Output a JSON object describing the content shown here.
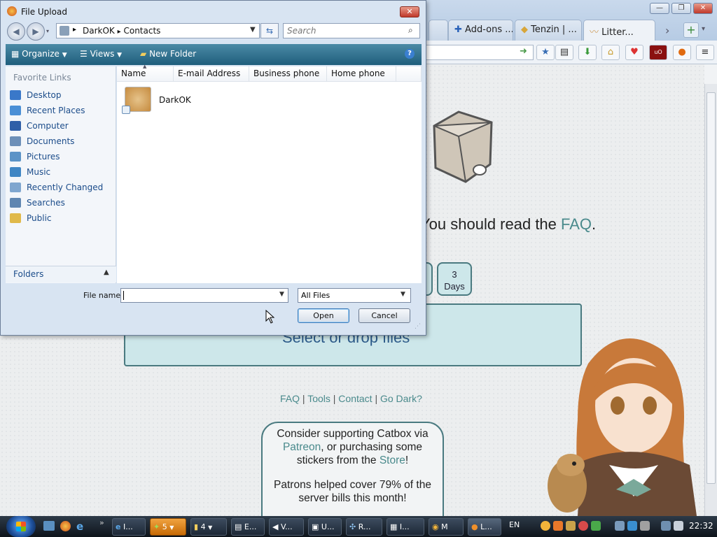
{
  "browser": {
    "tabs": [
      {
        "label": "Add-ons ...",
        "icon": "puzzle-icon"
      },
      {
        "label": "Tenzin | ...",
        "icon": "diamond-icon"
      },
      {
        "label": "Litter...",
        "icon": "litter-icon"
      }
    ],
    "window_controls": {
      "minimize": "—",
      "maximize": "❐",
      "close": "✕"
    },
    "new_tab": "+",
    "tab_scroll": "›",
    "toolbar_icons": [
      "star-icon",
      "reading-list-icon",
      "download-icon",
      "home-icon",
      "pocket-icon",
      "ublock-icon",
      "firefox-icon",
      "menu-icon"
    ]
  },
  "page": {
    "faq_prefix": "You should read the ",
    "faq_link": "FAQ",
    "faq_suffix": ".",
    "days_button": {
      "line1": "3",
      "line2": "Days"
    },
    "drop_text": "Select or drop files",
    "footer_links": {
      "faq": "FAQ",
      "tools": "Tools",
      "contact": "Contact",
      "go_dark": "Go Dark?",
      "separator": "|"
    },
    "support": {
      "line1": "Consider supporting Catbox via",
      "patreon": "Patreon",
      "line2_rest": ", or purchasing some",
      "line3_pre": "stickers from the ",
      "store": "Store",
      "line3_post": "!",
      "para2": "Patrons helped cover 79% of the server bills this month!"
    }
  },
  "dialog": {
    "title": "File Upload",
    "close_label": "✕",
    "back": "◀",
    "forward": "▶",
    "breadcrumb": [
      "DarkOK",
      "Contacts"
    ],
    "breadcrumb_sep": "▸",
    "search_placeholder": "Search",
    "toolbar": {
      "organize": "Organize",
      "views": "Views",
      "new_folder": "New Folder"
    },
    "favorite_links_heading": "Favorite Links",
    "favorites": [
      {
        "label": "Desktop",
        "color": "#3a78c9"
      },
      {
        "label": "Recent Places",
        "color": "#4a8fd6"
      },
      {
        "label": "Computer",
        "color": "#2f5fa8"
      },
      {
        "label": "Documents",
        "color": "#6c8fb8"
      },
      {
        "label": "Pictures",
        "color": "#5b93c7"
      },
      {
        "label": "Music",
        "color": "#3f86c4"
      },
      {
        "label": "Recently Changed",
        "color": "#7fa6cf"
      },
      {
        "label": "Searches",
        "color": "#5f86b1"
      },
      {
        "label": "Public",
        "color": "#e0b94a"
      }
    ],
    "folders_label": "Folders",
    "columns": [
      "Name",
      "E-mail Address",
      "Business phone",
      "Home phone"
    ],
    "contacts": [
      {
        "name": "DarkOK"
      }
    ],
    "file_name_label": "File name:",
    "file_name_value": "",
    "file_type": "All Files",
    "open_label": "Open",
    "cancel_label": "Cancel"
  },
  "taskbar": {
    "buttons": [
      {
        "label": "I..."
      },
      {
        "label": "5"
      },
      {
        "label": "4"
      },
      {
        "label": "E..."
      },
      {
        "label": "V..."
      },
      {
        "label": "U..."
      },
      {
        "label": "R..."
      },
      {
        "label": "I..."
      },
      {
        "label": "M"
      },
      {
        "label": "L..."
      }
    ],
    "language": "EN",
    "clock": "22:32"
  }
}
